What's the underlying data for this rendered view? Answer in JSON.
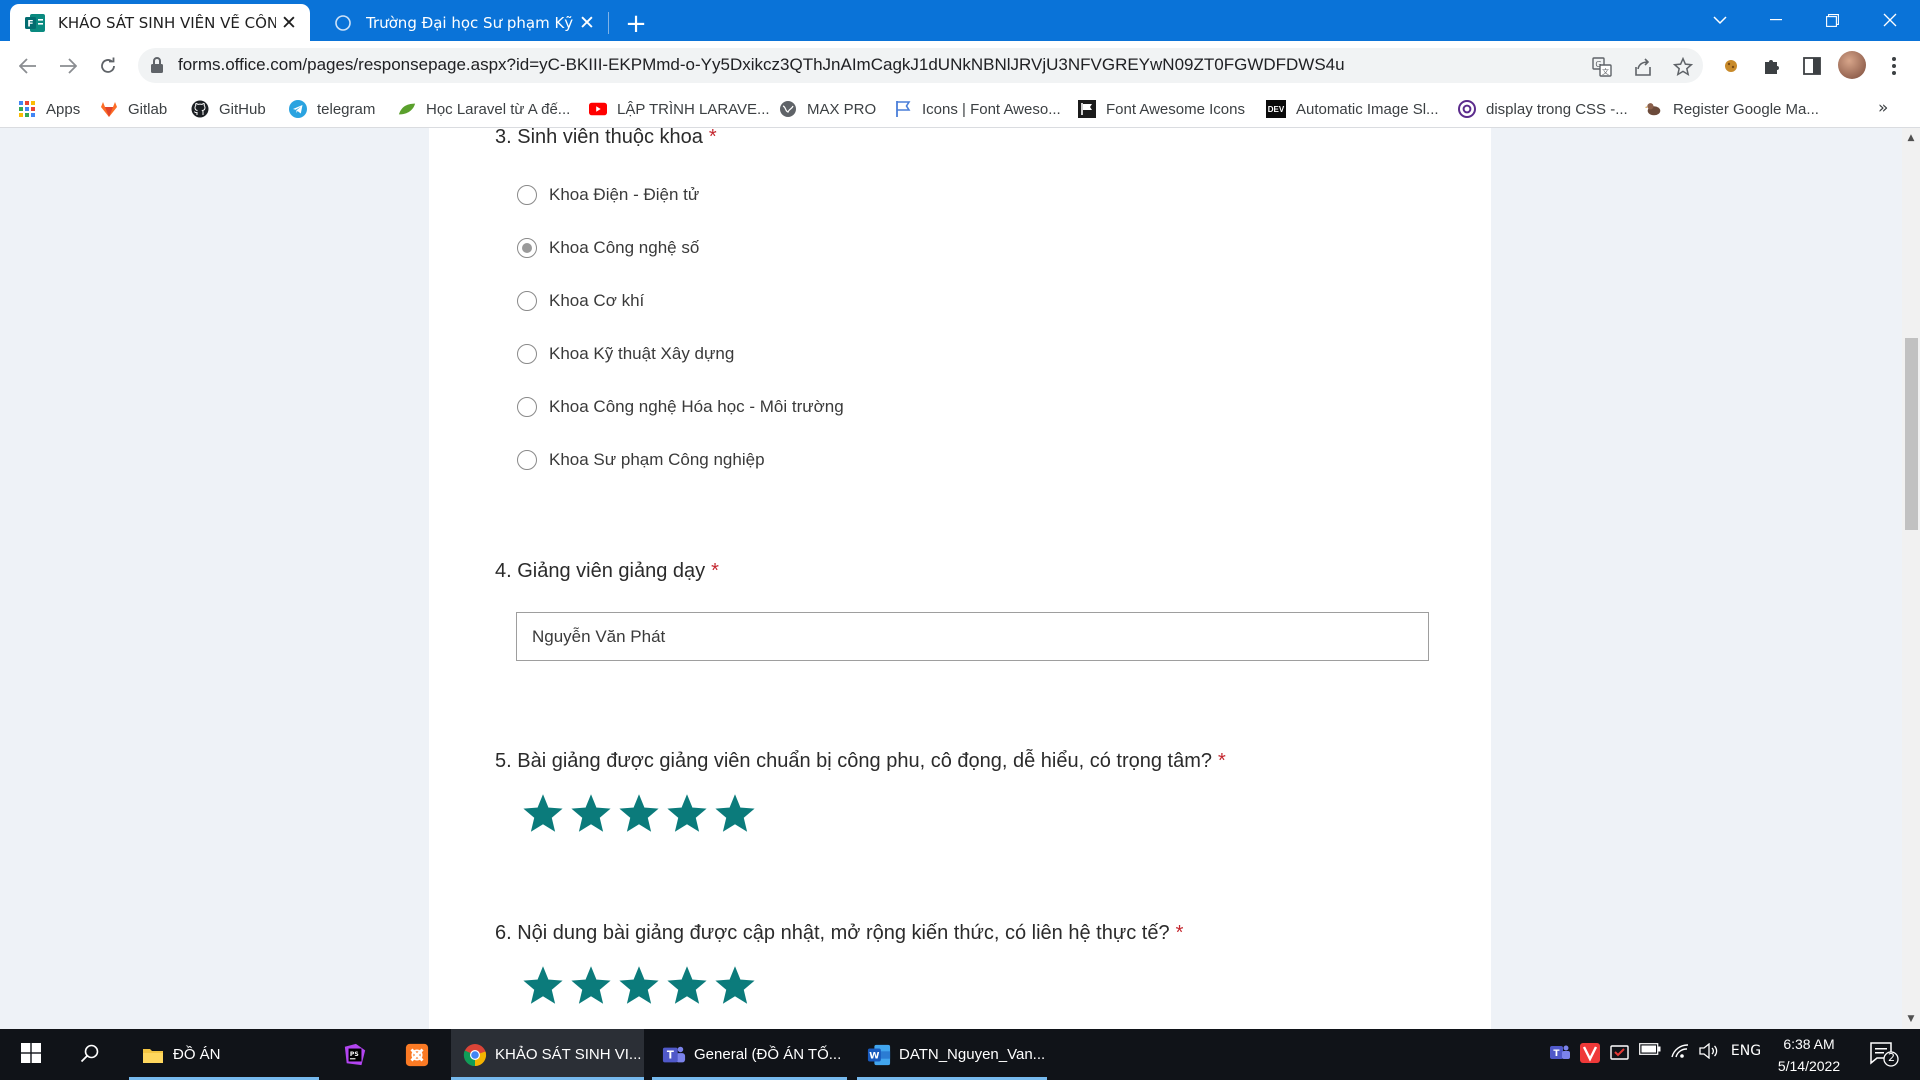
{
  "browser": {
    "tabs": [
      {
        "title": "KHẢO SÁT SINH VIÊN VỀ CÔNG",
        "close": "✕"
      },
      {
        "title": "Trường Đại học Sư phạm Kỹ thuậ",
        "close": "✕"
      }
    ],
    "new_tab": "+",
    "url": "forms.office.com/pages/responsepage.aspx?id=yC-BKIII-EKPMmd-o-Yy5Dxikcz3QThJnAImCagkJ1dUNkNBNlJRVjU3NFVGREYwN09ZT0FGWDFDWS4u",
    "bookmarks": [
      {
        "label": "Apps",
        "icon": "apps-grid-icon"
      },
      {
        "label": "Gitlab",
        "icon": "gitlab-icon"
      },
      {
        "label": "GitHub",
        "icon": "github-icon"
      },
      {
        "label": "telegram",
        "icon": "telegram-icon"
      },
      {
        "label": "Học Laravel từ A đế...",
        "icon": "leaf-icon"
      },
      {
        "label": "LẬP TRÌNH LARAVE...",
        "icon": "youtube-icon"
      },
      {
        "label": "MAX PRO",
        "icon": "globe-icon"
      },
      {
        "label": "Icons | Font Aweso...",
        "icon": "flag-icon"
      },
      {
        "label": "Font Awesome Icons",
        "icon": "font-awesome-icon"
      },
      {
        "label": "Automatic Image Sl...",
        "icon": "dev-icon"
      },
      {
        "label": "display trong CSS -...",
        "icon": "at-icon"
      },
      {
        "label": "Register Google Ma...",
        "icon": "bird-icon"
      }
    ],
    "bookmarks_more": "»"
  },
  "form": {
    "q3": {
      "title": "3. Sinh viên thuộc khoa",
      "required_mark": "*",
      "options": [
        {
          "label": "Khoa Điện - Điện tử",
          "checked": false
        },
        {
          "label": "Khoa Công nghệ số",
          "checked": true
        },
        {
          "label": "Khoa Cơ khí",
          "checked": false
        },
        {
          "label": "Khoa Kỹ thuật Xây dựng",
          "checked": false
        },
        {
          "label": "Khoa Công nghệ Hóa học - Môi trường",
          "checked": false
        },
        {
          "label": "Khoa Sư phạm Công nghiệp",
          "checked": false
        }
      ]
    },
    "q4": {
      "title": "4. Giảng viên giảng dạy",
      "required_mark": "*",
      "value": "Nguyễn Văn Phát"
    },
    "q5": {
      "title": "5. Bài giảng được giảng viên chuẩn bị công phu, cô đọng, dễ hiểu, có trọng tâm?",
      "required_mark": "*",
      "rating": 5,
      "max_rating": 5
    },
    "q6": {
      "title": "6. Nội dung bài giảng được cập nhật, mở rộng kiến thức, có liên hệ thực tế?",
      "required_mark": "*",
      "rating": 5,
      "max_rating": 5
    }
  },
  "taskbar": {
    "items": [
      {
        "label": "ĐỒ ÁN",
        "icon": "folder-icon"
      },
      {
        "label": "",
        "icon": "phpstorm-icon"
      },
      {
        "label": "",
        "icon": "xampp-icon"
      },
      {
        "label": "KHẢO SÁT SINH VI...",
        "icon": "chrome-icon"
      },
      {
        "label": "General (ĐỒ ÁN TỐ...",
        "icon": "teams-icon"
      },
      {
        "label": "DATN_Nguyen_Van...",
        "icon": "word-icon"
      }
    ],
    "language": "ENG",
    "time": "6:38 AM",
    "date": "5/14/2022",
    "notifications": "2"
  },
  "colors": {
    "chrome_blue": "#0a73d8",
    "star_teal": "#0b7b7b",
    "required_red": "#c4262e",
    "page_bg": "#eef2f7"
  }
}
